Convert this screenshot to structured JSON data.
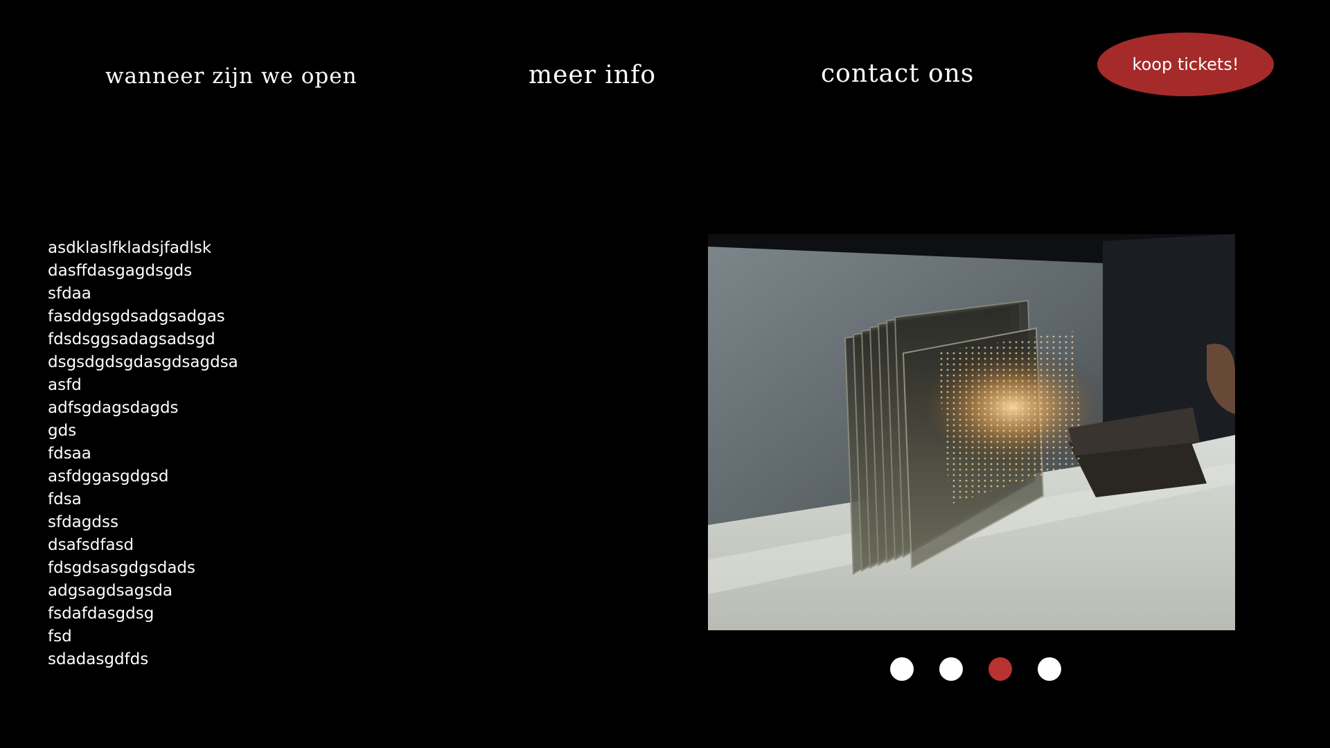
{
  "nav": {
    "items": [
      {
        "label": "wanneer zijn we open"
      },
      {
        "label": "meer info"
      },
      {
        "label": "contact ons"
      }
    ],
    "cta_label": "koop tickets!"
  },
  "content": {
    "lines": [
      "asdklaslfkladsjfadlsk",
      "dasffdasgagdsgds",
      "sfdaa",
      "fasddgsgdsadgsadgas",
      "fdsdsggsadagsadsgd",
      "dsgsdgdsgdasgdsagdsa",
      "asfd",
      "adfsgdagsdagds",
      "gds",
      "fdsaa",
      "asfdggasgdgsd",
      "fdsa",
      "sfdagdss",
      "dsafsdfasd",
      "fdsgdsasgdgsdads",
      "adgsagdsagsda",
      "fsdafdasgdsg",
      "fsd",
      "sdadasgdfds"
    ]
  },
  "carousel": {
    "slide_count": 4,
    "active_index": 2
  },
  "colors": {
    "background": "#000000",
    "accent": "#a52a2a",
    "active_dot": "#b83232",
    "inactive_dot": "#ffffff",
    "text": "#ffffff"
  }
}
